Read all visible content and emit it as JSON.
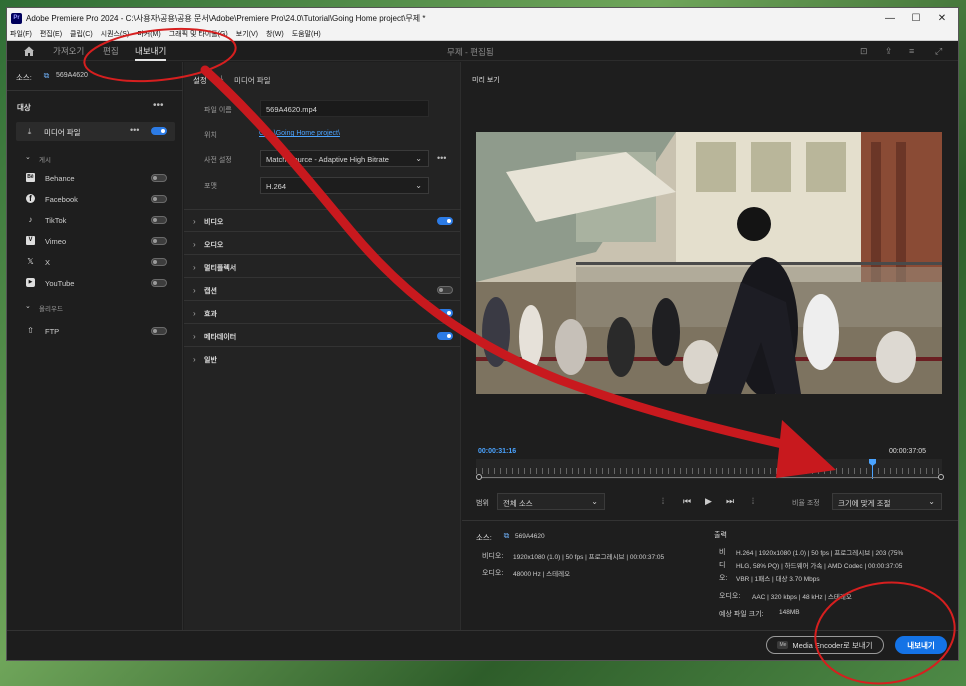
{
  "window": {
    "title": "Adobe Premiere Pro 2024 - C:\\사용자\\공용\\공용 문서\\Adobe\\Premiere Pro\\24.0\\Tutorial\\Going Home project\\무제 *",
    "app_icon": "Pr",
    "controls": {
      "minimize": "—",
      "maximize": "☐",
      "close": "✕"
    }
  },
  "menubar": [
    "파일(F)",
    "편집(E)",
    "클립(C)",
    "시퀀스(S)",
    "마커(M)",
    "그래픽 및 타이틀(G)",
    "보기(V)",
    "창(W)",
    "도움말(H)"
  ],
  "topnav": {
    "tabs": [
      "가져오기",
      "편집",
      "내보내기"
    ],
    "active_tab": "내보내기",
    "project_title": "무제 - 편집됨"
  },
  "left": {
    "source_label": "소스:",
    "source_name": "569A4620",
    "dest_label": "대상",
    "media_file_label": "미디어 파일",
    "publish_label": "게시",
    "publish_items": [
      {
        "icon": "behance-icon",
        "glyph": "Bē",
        "label": "Behance",
        "on": false
      },
      {
        "icon": "facebook-icon",
        "glyph": "f",
        "label": "Facebook",
        "on": false
      },
      {
        "icon": "tiktok-icon",
        "glyph": "♪",
        "label": "TikTok",
        "on": false
      },
      {
        "icon": "vimeo-icon",
        "glyph": "V",
        "label": "Vimeo",
        "on": false
      },
      {
        "icon": "x-icon",
        "glyph": "𝕏",
        "label": "X",
        "on": false
      },
      {
        "icon": "youtube-icon",
        "glyph": "▶",
        "label": "YouTube",
        "on": false
      }
    ],
    "upload_label": "올리우드",
    "ftp_label": "FTP"
  },
  "mid": {
    "settings_label": "설정",
    "media_file_label": "미디어 파일",
    "filename_label": "파일 이름",
    "filename_value": "569A4620.mp4",
    "location_label": "위치",
    "location_value": "C:\\...\\Going Home project\\",
    "preset_label": "사전 설정",
    "preset_value": "Match Source - Adaptive High Bitrate",
    "format_label": "포맷",
    "format_value": "H.264",
    "sections": [
      {
        "label": "비디오",
        "toggle": true,
        "on": true
      },
      {
        "label": "오디오",
        "toggle": false,
        "on": false
      },
      {
        "label": "멀티플렉서",
        "toggle": false,
        "on": false
      },
      {
        "label": "캡션",
        "toggle": true,
        "on": false
      },
      {
        "label": "효과",
        "toggle": true,
        "on": true
      },
      {
        "label": "메타데이터",
        "toggle": true,
        "on": true
      },
      {
        "label": "일반",
        "toggle": false,
        "on": false
      }
    ]
  },
  "preview": {
    "title": "미리 보기",
    "current_time": "00:00:31:16",
    "end_time": "00:00:37:05",
    "playhead_fraction": 0.85,
    "range_label": "범위",
    "range_value": "전체 소스",
    "scale_label": "비율 조정",
    "scale_value": "크기에 맞게 조절"
  },
  "summary": {
    "source_label": "소스:",
    "source_name": "569A4620",
    "source_video_label": "비디오:",
    "source_video_value": "1920x1080 (1.0) | 50 fps | 프로그레시브 | 00:00:37:05",
    "source_audio_label": "오디오:",
    "source_audio_value": "48000 Hz | 스테레오",
    "output_label": "출력",
    "output_lines": [
      {
        "label": "비",
        "value": "H.264 | 1920x1080 (1.0) | 50 fps | 프로그레시브 | 203 (75%"
      },
      {
        "label": "디",
        "value": "HLG, 58% PQ) | 하드웨어 가속 | AMD Codec | 00:00:37:05"
      },
      {
        "label": "오:",
        "value": "VBR | 1패스 | 대상 3.70 Mbps"
      }
    ],
    "output_audio_label": "오디오:",
    "output_audio_value": "AAC | 320 kbps | 48 kHz | 스테레오",
    "filesize_label": "예상 파일 크기:",
    "filesize_value": "148MB"
  },
  "bottom": {
    "encoder_button": "Media Encoder로 보내기",
    "export_button": "내보내기"
  },
  "colors": {
    "accent": "#2c7be5",
    "annotation": "#d61f1f",
    "link": "#4aa3ff"
  }
}
